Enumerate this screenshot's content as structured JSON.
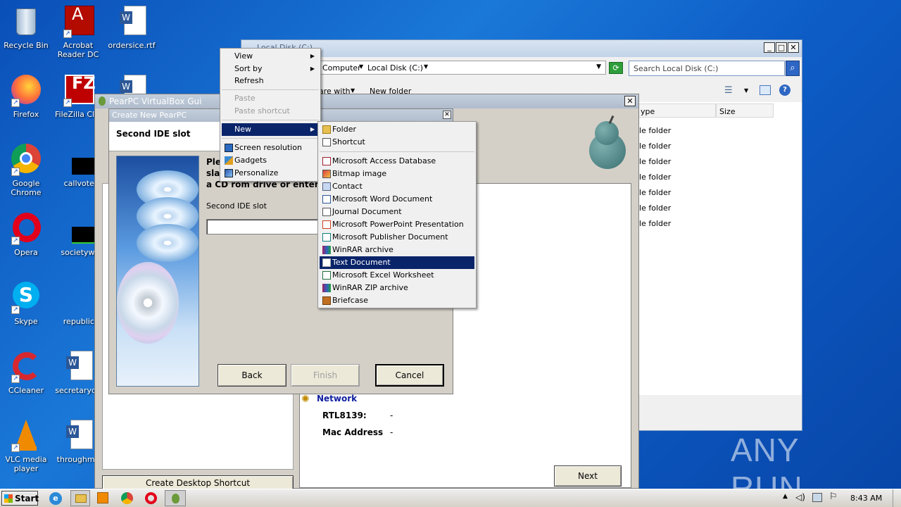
{
  "desktop": {
    "icons": [
      {
        "label": "Recycle Bin"
      },
      {
        "label": "Acrobat Reader DC"
      },
      {
        "label": "ordersice.rtf"
      },
      {
        "label": "Firefox"
      },
      {
        "label": "FileZilla Clie"
      },
      {
        "label": "Google Chrome"
      },
      {
        "label": "callvote.jp"
      },
      {
        "label": "Opera"
      },
      {
        "label": "societywatc"
      },
      {
        "label": "Skype"
      },
      {
        "label": "republicoff"
      },
      {
        "label": "CCleaner"
      },
      {
        "label": "secretaryde"
      },
      {
        "label": "VLC media player"
      },
      {
        "label": "throughmo"
      }
    ]
  },
  "explorer": {
    "title": "Local Disk (C:)",
    "breadcrumb": [
      "Computer",
      "Local Disk (C:)"
    ],
    "search_placeholder": "Search Local Disk (C:)",
    "toolbar": {
      "share": "are with",
      "new_folder": "New folder"
    },
    "columns": {
      "type": "ype",
      "size": "Size"
    },
    "rows": [
      "ile folder",
      "ile folder",
      "ile folder",
      "ile folder",
      "ile folder",
      "ile folder",
      "ile folder"
    ]
  },
  "pearpc": {
    "title": "PearPC VirtualBox Gui",
    "network_label": "Network",
    "rtl_label": "RTL8139:",
    "rtl_value": "-",
    "mac_label": "Mac Address",
    "mac_value": "-",
    "create_shortcut": "Create Desktop Shortcut",
    "next": "Next"
  },
  "wizard": {
    "title": "Create New PearPC",
    "heading": "Second IDE slot",
    "instr_line1": "Ple",
    "instr_line2": "sla",
    "instr_line3": "a CD rom drive or enter a",
    "field_label": "Second IDE slot",
    "field_value": "",
    "back": "Back",
    "finish": "Finish",
    "cancel": "Cancel"
  },
  "context_menu": {
    "items": [
      {
        "label": "View",
        "arrow": "▶"
      },
      {
        "label": "Sort by",
        "arrow": "▶"
      },
      {
        "label": "Refresh"
      },
      {
        "label": "Paste"
      },
      {
        "label": "Paste shortcut"
      },
      {
        "label": "New",
        "arrow": "▶"
      },
      {
        "label": "Screen resolution"
      },
      {
        "label": "Gadgets"
      },
      {
        "label": "Personalize"
      }
    ]
  },
  "new_submenu": {
    "items": [
      {
        "label": "Folder"
      },
      {
        "label": "Shortcut"
      },
      {
        "label": "Microsoft Access Database"
      },
      {
        "label": "Bitmap image"
      },
      {
        "label": "Contact"
      },
      {
        "label": "Microsoft Word Document"
      },
      {
        "label": "Journal Document"
      },
      {
        "label": "Microsoft PowerPoint Presentation"
      },
      {
        "label": "Microsoft Publisher Document"
      },
      {
        "label": "WinRAR archive"
      },
      {
        "label": "Text Document"
      },
      {
        "label": "Microsoft Excel Worksheet"
      },
      {
        "label": "WinRAR ZIP archive"
      },
      {
        "label": "Briefcase"
      }
    ]
  },
  "taskbar": {
    "start": "Start",
    "time": "8:43 AM"
  },
  "watermark": "ANY RUN",
  "colors": {
    "menu_highlight": "#0a246a",
    "desktop": "#1a78d8"
  }
}
